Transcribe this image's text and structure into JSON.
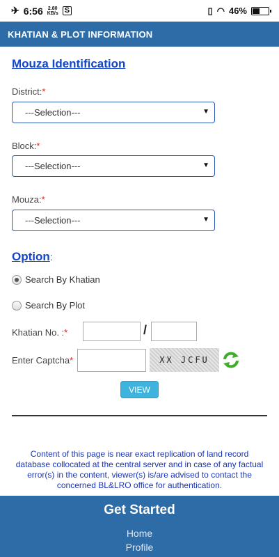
{
  "status_bar": {
    "time": "6:56",
    "net_speed_top": "2.80",
    "net_speed_bottom": "KB/s",
    "battery": "46%",
    "battery_level": 0.46
  },
  "header": {
    "title": "KHATIAN & PLOT INFORMATION"
  },
  "mouza": {
    "section_title": "Mouza Identification",
    "district_label": "District:",
    "district_value": "---Selection---",
    "block_label": "Block:",
    "block_value": "---Selection---",
    "mouza_label": "Mouza:",
    "mouza_value": "---Selection---",
    "required_mark": "*"
  },
  "option": {
    "section_title": "Option",
    "colon": ":",
    "search_by_khatian": "Search By Khatian",
    "search_by_plot": "Search By Plot",
    "khatian_label": "Khatian No. :",
    "slash": "/",
    "captcha_label": "Enter Captcha",
    "captcha_text": "XX JCFU",
    "view_button": "VIEW"
  },
  "notice": "Content of this page is near exact replication of land record database collocated at the central server and in case of any factual error(s) in the content, viewer(s) is/are advised to contact the concerned BL&LRO office for authentication.",
  "footer": {
    "title": "Get Started",
    "links": [
      "Home",
      "Profile"
    ]
  }
}
